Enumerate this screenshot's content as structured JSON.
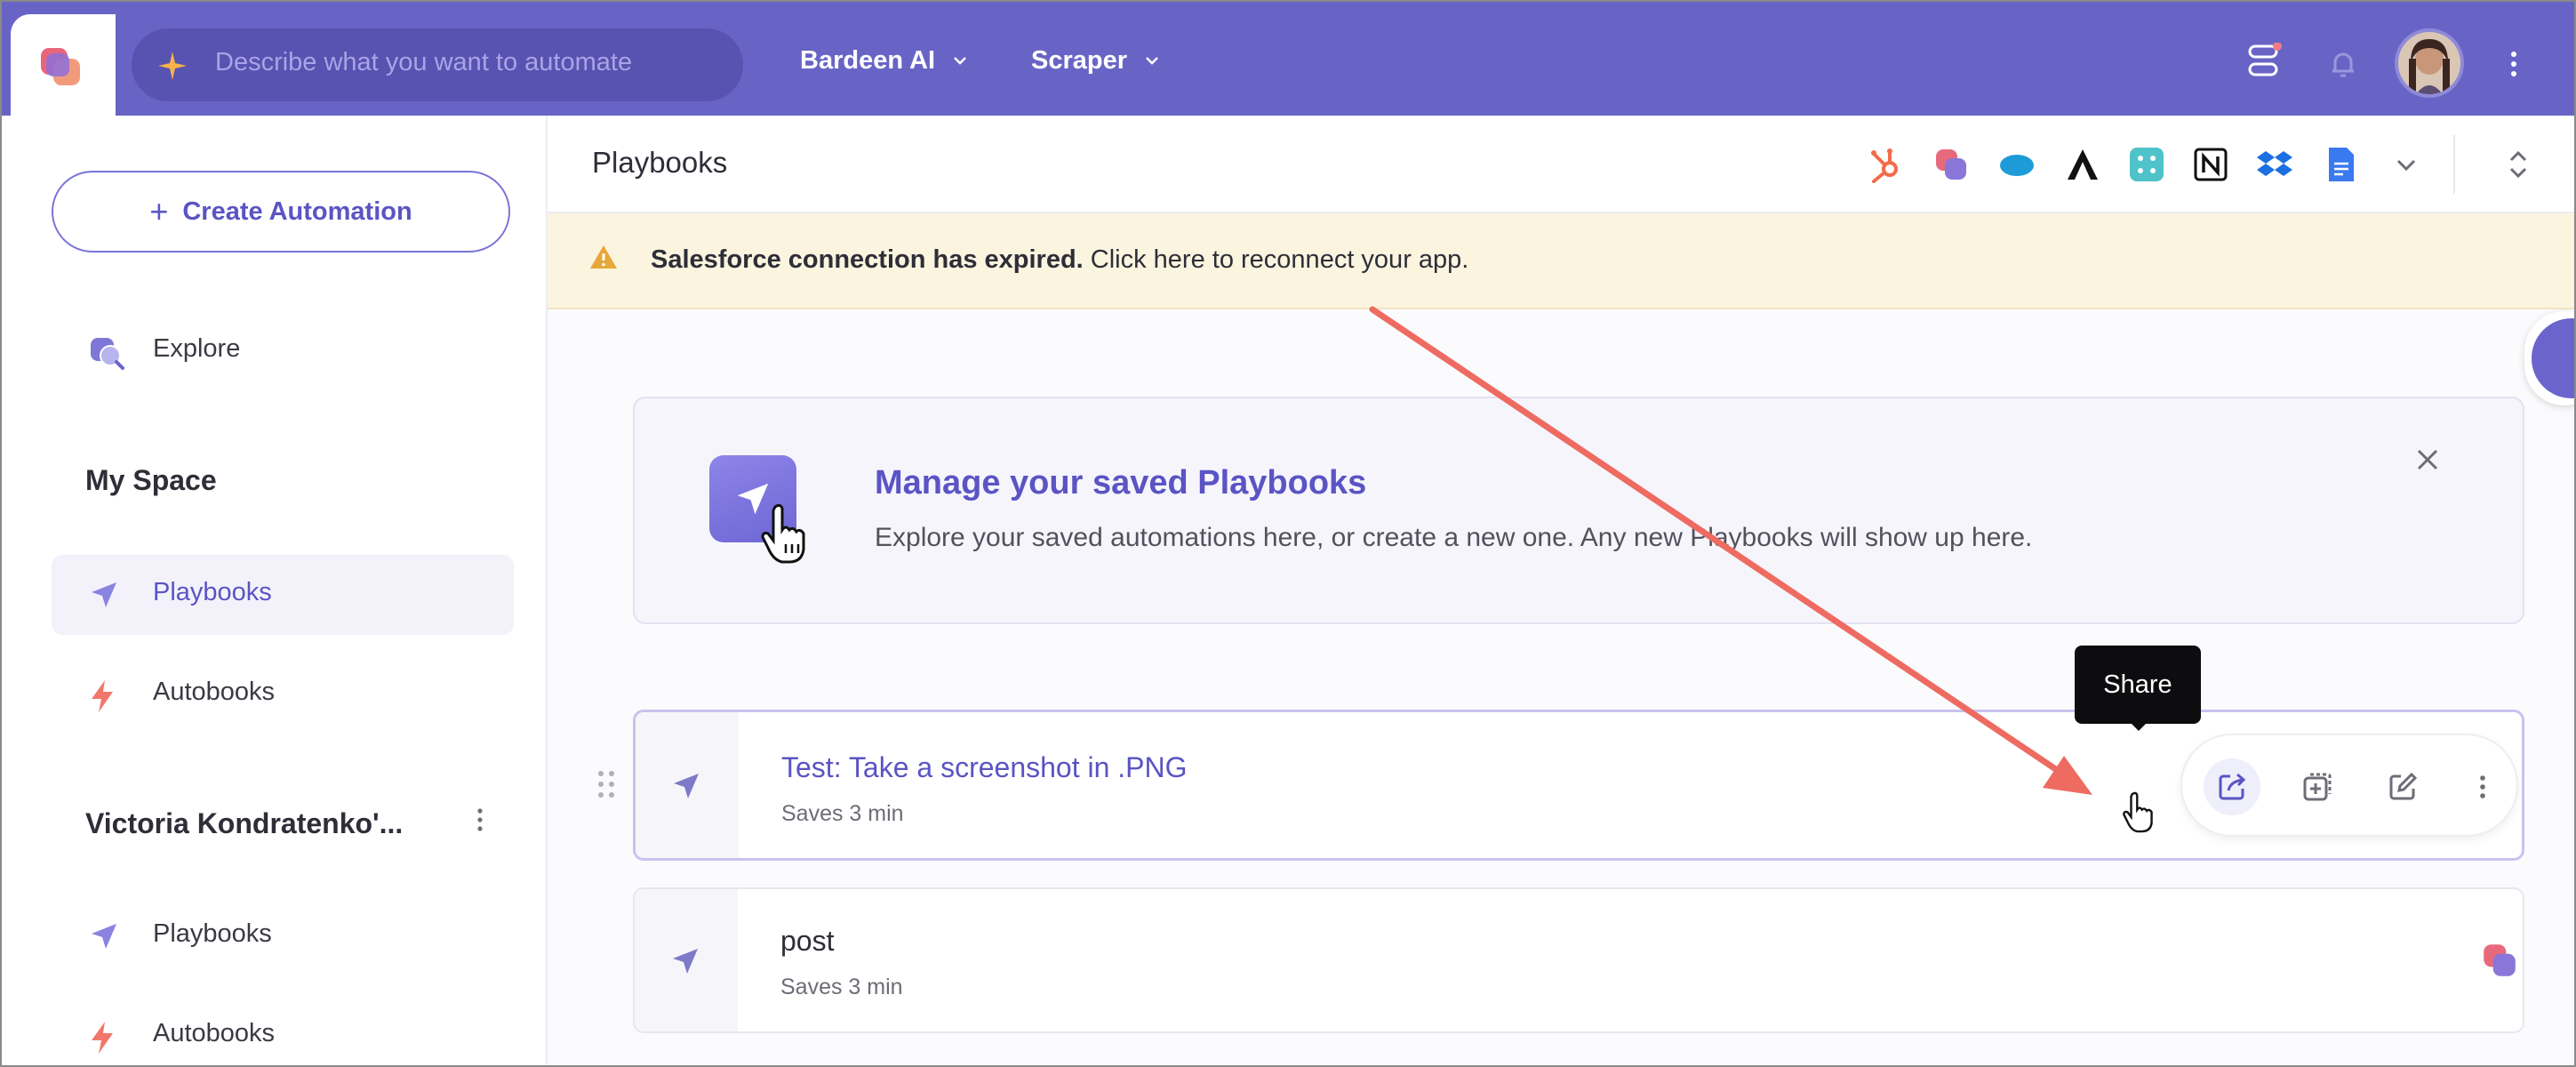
{
  "topbar": {
    "logo_icon": "bardeen-logo-icon",
    "search_placeholder": "Describe what you want to automate",
    "nav": [
      {
        "label": "Bardeen AI",
        "icon": "chevron-down-icon"
      },
      {
        "label": "Scraper",
        "icon": "chevron-down-icon"
      }
    ],
    "right_icons": [
      "tasks-icon",
      "bell-icon",
      "avatar",
      "more-vertical-icon"
    ]
  },
  "sidebar": {
    "create_label": "Create Automation",
    "explore_label": "Explore",
    "my_space_heading": "My Space",
    "my_space_items": [
      {
        "label": "Playbooks",
        "icon": "playbook-arrow-icon",
        "active": true
      },
      {
        "label": "Autobooks",
        "icon": "bolt-icon",
        "active": false
      }
    ],
    "workspace_heading": "Victoria Kondratenko'...",
    "workspace_items": [
      {
        "label": "Playbooks",
        "icon": "playbook-arrow-icon"
      },
      {
        "label": "Autobooks",
        "icon": "bolt-icon"
      }
    ]
  },
  "main": {
    "title": "Playbooks",
    "app_icons": [
      "hubspot-icon",
      "bardeen-icon",
      "salesforce-icon",
      "apollo-icon",
      "clearbit-icon",
      "notion-icon",
      "dropbox-icon",
      "google-docs-icon",
      "chevron-down-icon",
      "expand-collapse-icon"
    ],
    "alert": {
      "bold": "Salesforce connection has expired.",
      "text": " Click here to reconnect your app."
    },
    "info_card": {
      "heading": "Manage your saved Playbooks",
      "body": "Explore your saved automations here, or create a new one. Any new Playbooks will show up here."
    },
    "playbooks": [
      {
        "name": "Test: Take a screenshot in .PNG",
        "sub": "Saves 3 min"
      },
      {
        "name": "post",
        "sub": "Saves 3 min"
      }
    ],
    "row_actions": [
      "share-icon",
      "duplicate-icon",
      "edit-icon",
      "more-vertical-icon"
    ],
    "tooltip": "Share"
  },
  "colors": {
    "brand": "#6864c6",
    "accent_text": "#5a54c4",
    "alert_bg": "#fbf4df",
    "annotation_arrow": "#ee6b62"
  }
}
